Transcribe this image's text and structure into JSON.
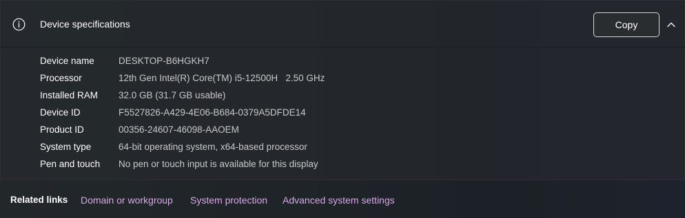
{
  "header": {
    "title": "Device specifications",
    "copy_label": "Copy"
  },
  "specs": [
    {
      "label": "Device name",
      "value": "DESKTOP-B6HGKH7"
    },
    {
      "label": "Processor",
      "value": "12th Gen Intel(R) Core(TM) i5-12500H   2.50 GHz"
    },
    {
      "label": "Installed RAM",
      "value": "32.0 GB (31.7 GB usable)"
    },
    {
      "label": "Device ID",
      "value": "F5527826-A429-4E06-B684-0379A5DFDE14"
    },
    {
      "label": "Product ID",
      "value": "00356-24607-46098-AAOEM"
    },
    {
      "label": "System type",
      "value": "64-bit operating system, x64-based processor"
    },
    {
      "label": "Pen and touch",
      "value": "No pen or touch input is available for this display"
    }
  ],
  "related": {
    "title": "Related links",
    "links": [
      "Domain or workgroup",
      "System protection",
      "Advanced system settings"
    ]
  },
  "colors": {
    "link": "#d7a8e8",
    "value_text": "#c8c8c8"
  },
  "icons": {
    "header_icon": "info-icon",
    "collapse_icon": "chevron-up-icon"
  }
}
